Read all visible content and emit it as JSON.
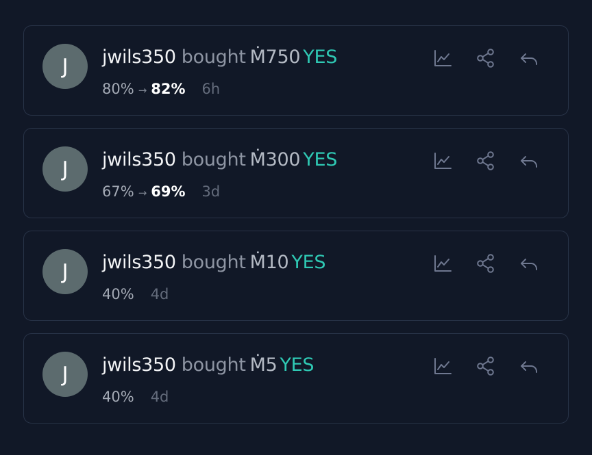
{
  "feed": {
    "trades": [
      {
        "avatar_initial": "J",
        "username": "jwils350",
        "verb": "bought",
        "amount": "Ṁ750",
        "outcome": "YES",
        "prob_before": "80%",
        "arrow": "→",
        "prob_after": "82%",
        "time": "6h"
      },
      {
        "avatar_initial": "J",
        "username": "jwils350",
        "verb": "bought",
        "amount": "Ṁ300",
        "outcome": "YES",
        "prob_before": "67%",
        "arrow": "→",
        "prob_after": "69%",
        "time": "3d"
      },
      {
        "avatar_initial": "J",
        "username": "jwils350",
        "verb": "bought",
        "amount": "Ṁ10",
        "outcome": "YES",
        "prob_before": "40%",
        "arrow": "",
        "prob_after": "",
        "time": "4d"
      },
      {
        "avatar_initial": "J",
        "username": "jwils350",
        "verb": "bought",
        "amount": "Ṁ5",
        "outcome": "YES",
        "prob_before": "40%",
        "arrow": "",
        "prob_after": "",
        "time": "4d"
      }
    ],
    "action_icons": [
      "chart-icon",
      "share-icon",
      "reply-icon"
    ]
  },
  "colors": {
    "background": "#111827",
    "card_border": "#283347",
    "yes": "#2fc9b4",
    "avatar": "#5c6b6e"
  }
}
